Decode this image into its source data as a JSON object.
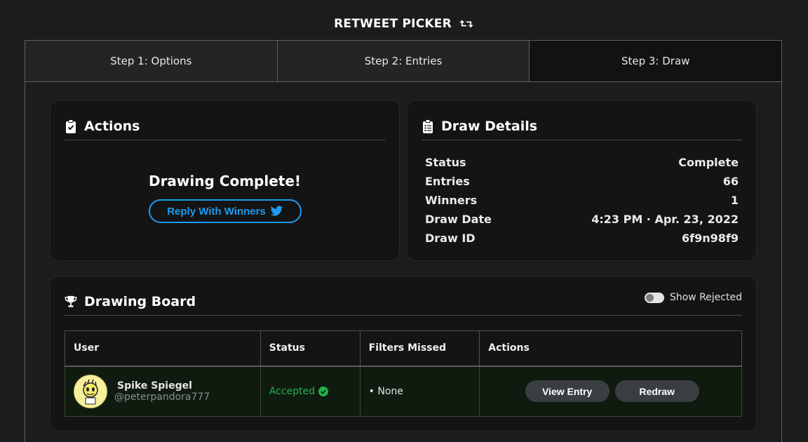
{
  "app": {
    "title": "RETWEET PICKER",
    "title_icon": "retweet-icon"
  },
  "steps": [
    {
      "label": "Step 1: Options"
    },
    {
      "label": "Step 2: Entries"
    },
    {
      "label": "Step 3: Draw",
      "active": true
    }
  ],
  "actions_card": {
    "title": "Actions",
    "icon": "clipboard-check-icon",
    "message": "Drawing Complete!",
    "reply_button": "Reply With Winners",
    "reply_icon": "twitter-icon"
  },
  "details_card": {
    "title": "Draw Details",
    "icon": "clipboard-list-icon",
    "rows": [
      {
        "label": "Status",
        "value": "Complete"
      },
      {
        "label": "Entries",
        "value": "66"
      },
      {
        "label": "Winners",
        "value": "1"
      },
      {
        "label": "Draw Date",
        "value": "4:23 PM · Apr. 23, 2022"
      },
      {
        "label": "Draw ID",
        "value": "6f9n98f9"
      }
    ]
  },
  "board": {
    "title": "Drawing Board",
    "icon": "trophy-icon",
    "toggle_label": "Show Rejected",
    "toggle_on": false,
    "columns": [
      "User",
      "Status",
      "Filters Missed",
      "Actions"
    ],
    "rows": [
      {
        "name": "Spike Spiegel",
        "handle": "@peterpandora777",
        "status": "Accepted",
        "filters_missed": "• None",
        "view_button": "View Entry",
        "redraw_button": "Redraw"
      }
    ]
  },
  "colors": {
    "twitter_blue": "#1d9bf0",
    "accepted_green": "#22b14c",
    "background": "#1b1c1e"
  }
}
